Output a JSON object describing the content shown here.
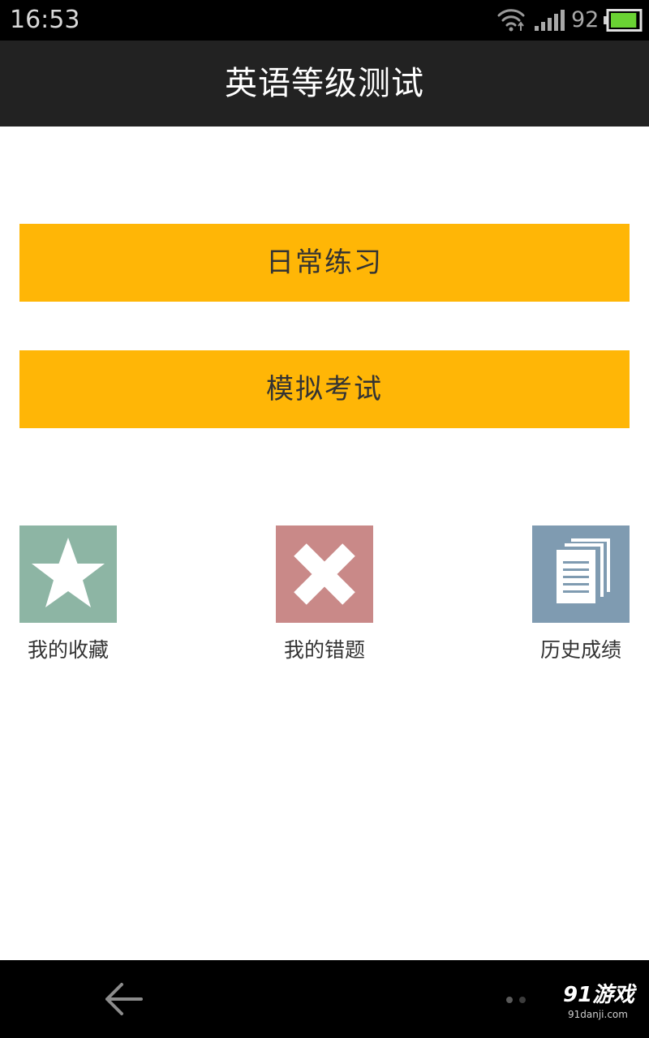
{
  "status_bar": {
    "time": "16:53",
    "battery_level": "92",
    "icons": [
      "wifi-icon",
      "signal-icon",
      "battery-icon"
    ],
    "battery_fill": 0.92,
    "battery_color": "#6ad233"
  },
  "header": {
    "title": "英语等级测试"
  },
  "main": {
    "buttons": [
      {
        "label": "日常练习"
      },
      {
        "label": "模拟考试"
      }
    ],
    "accent_color": "#ffb606"
  },
  "tiles": [
    {
      "label": "我的收藏",
      "icon": "star-icon",
      "color": "#8db5a4"
    },
    {
      "label": "我的错题",
      "icon": "cross-icon",
      "color": "#c98988"
    },
    {
      "label": "历史成绩",
      "icon": "documents-icon",
      "color": "#7f9bb1"
    }
  ],
  "nav_bar": {
    "icons": [
      "back-icon",
      "page-dots-icon"
    ]
  },
  "watermark": {
    "brand": "91游戏",
    "domain": "91danji.com"
  }
}
